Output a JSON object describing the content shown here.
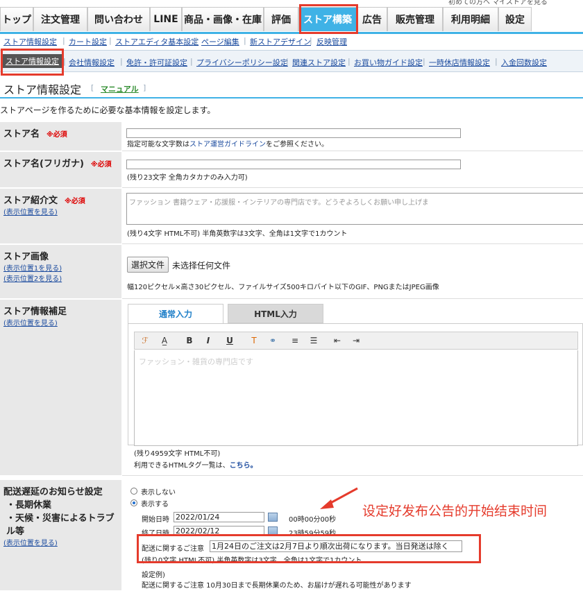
{
  "top_links": "初めての方へ    マイストアを見る",
  "tabs": [
    {
      "label": "トップ"
    },
    {
      "label": "注文管理"
    },
    {
      "label": "問い合わせ"
    },
    {
      "label": "LINE"
    },
    {
      "label": "商品・画像・在庫"
    },
    {
      "label": "評価"
    },
    {
      "label": "ストア構築"
    },
    {
      "label": "広告"
    },
    {
      "label": "販売管理"
    },
    {
      "label": "利用明細"
    },
    {
      "label": "設定"
    }
  ],
  "subnav1": [
    "ストア情報設定",
    "カート設定",
    "ストアエディタ基本設定",
    "ページ編集",
    "新ストアデザイン",
    "反映管理"
  ],
  "subnav2": [
    "ストア情報設定",
    "会社情報設定",
    "免許・許可証設定",
    "プライバシーポリシー設定",
    "関連ストア設定",
    "お買い物ガイド設定",
    "一時休店情報設定",
    "入金回数設定"
  ],
  "page": {
    "title": "ストア情報設定",
    "manual": "マニュアル",
    "description": "ストアページを作るために必要な基本情報を設定します。"
  },
  "fields": {
    "store_name": {
      "label": "ストア名",
      "required": "※必須",
      "note_prefix": "指定可能な文字数は",
      "note_link": "ストア運営ガイドライン",
      "note_suffix": "をご参照ください。"
    },
    "store_kana": {
      "label": "ストア名(フリガナ)",
      "required": "※必須",
      "note": "(残り23文字 全角カタカナのみ入力可)"
    },
    "store_intro": {
      "label": "ストア紹介文",
      "required": "※必須",
      "link": "(表示位置を見る)",
      "value": "ファッション 書籍ウェア・応援服・インテリアの専門店です。どうぞよろしくお願い申し上げます。",
      "note": "(残り4文字 HTML不可) 半角英数字は3文字、全角は1文字で1カウント"
    },
    "store_image": {
      "label": "ストア画像",
      "link1": "(表示位置1を見る)",
      "link2": "(表示位置2を見る)",
      "button": "選択文件",
      "status": "未选择任何文件",
      "note": "幅120ピクセル×高さ30ピクセル、ファイルサイズ500キロバイト以下のGIF、PNGまたはJPEG画像"
    },
    "store_supplement": {
      "label": "ストア情報補足",
      "link": "(表示位置を見る)",
      "tab_normal": "通常入力",
      "tab_html": "HTML入力",
      "editor_text": "ファッション・雑貨の専門店です",
      "note1": "(残り4959文字 HTML不可)",
      "note2_prefix": "利用できるHTMLタグ一覧は、",
      "note2_link": "こちら。"
    },
    "delay_notice": {
      "label": "配送遅延のお知らせ設定",
      "bullet1": "・長期休業",
      "bullet2": "・天候・災害によるトラブル等",
      "link": "(表示位置を見る)",
      "opt_hide": "表示しない",
      "opt_show": "表示する",
      "start_label": "開始日時",
      "start_date": "2022/01/24",
      "start_time": "00時00分00秒",
      "end_label": "終了日時",
      "end_date": "2022/02/12",
      "end_time": "23時59分59秒",
      "msg_label": "配送に関するご注意",
      "msg_value": "1月24日のご注文は2月7日より順次出荷になります。当日発送は除く",
      "msg_note": "(残り0文字 HTML不可) 半角英数字は3文字、全角は1文字で1カウント",
      "example_label": "設定例)",
      "example_text": "配送に関するご注意 10月30日まで長期休業のため、お届けが遅れる可能性があります"
    }
  },
  "annotation": "设定好发布公告的开始结束时间"
}
